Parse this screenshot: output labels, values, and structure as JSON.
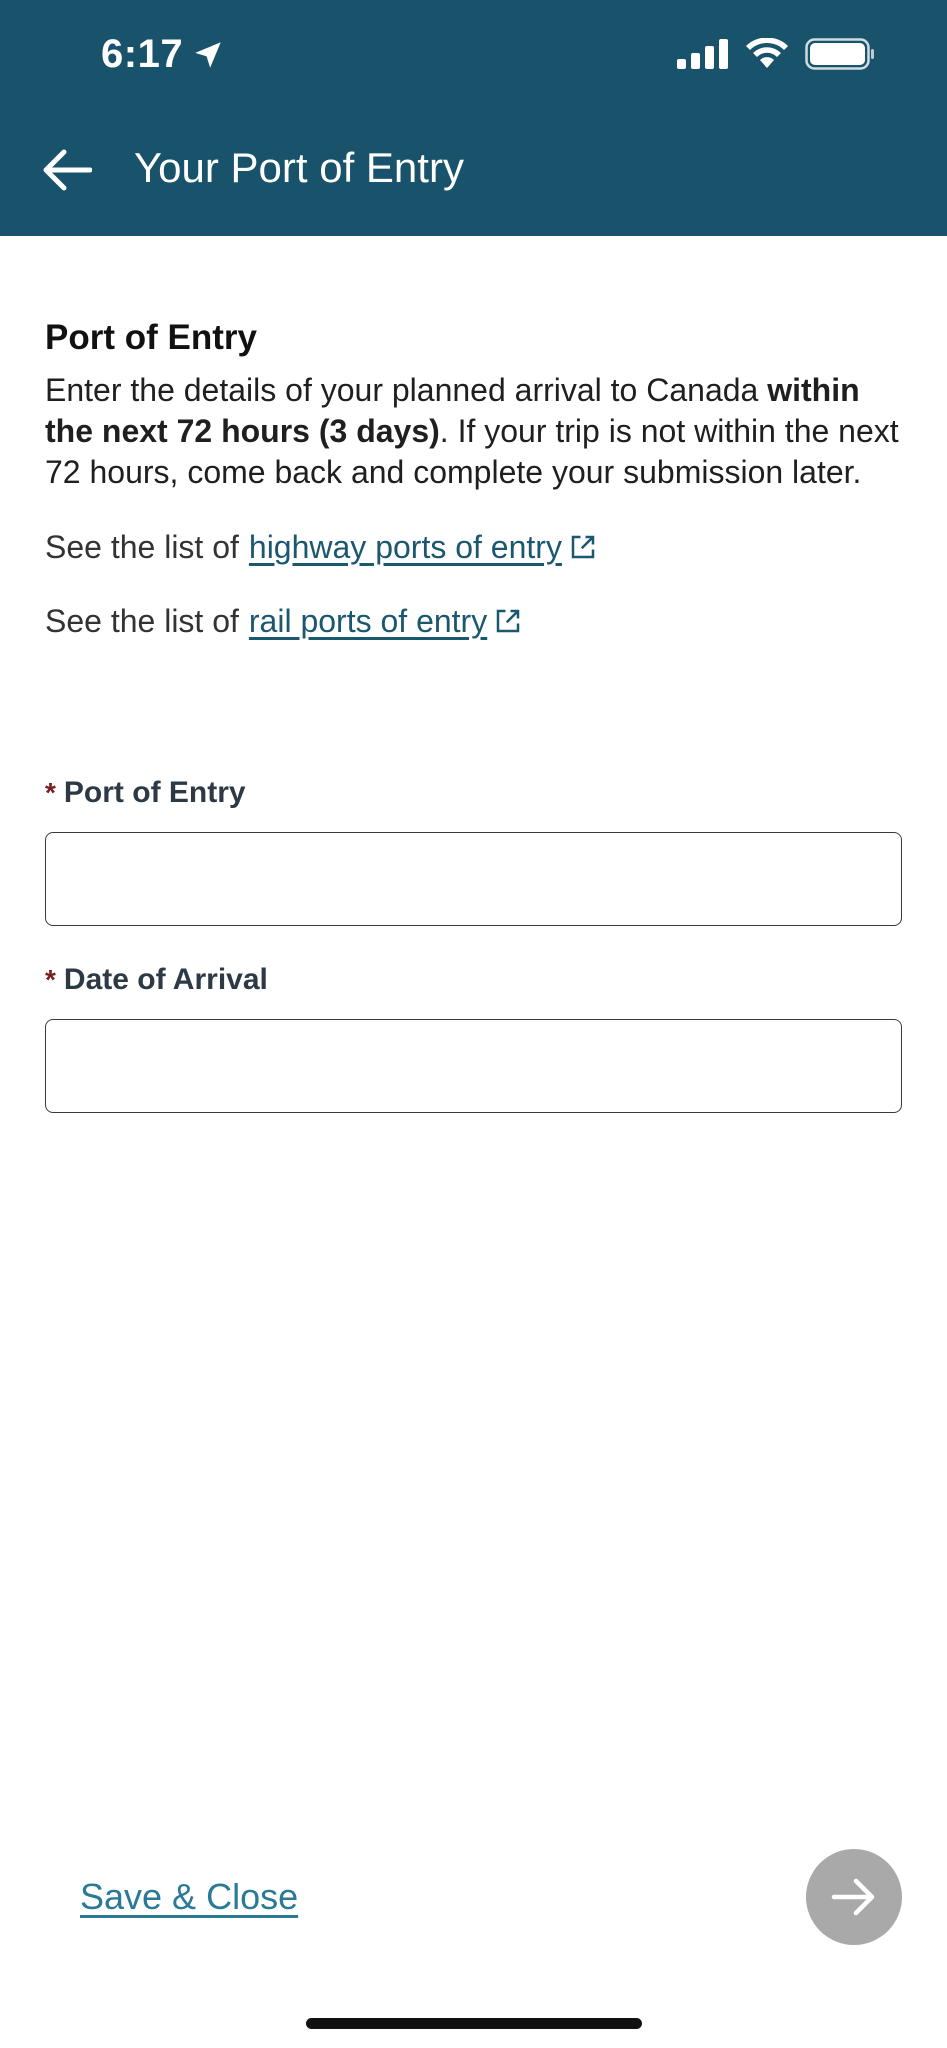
{
  "status_bar": {
    "time": "6:17",
    "location_icon": "location-arrow-icon",
    "signal_icon": "cellular-signal-icon",
    "wifi_icon": "wifi-icon",
    "battery_icon": "battery-icon"
  },
  "header": {
    "back_icon": "arrow-left-icon",
    "title": "Your Port of Entry",
    "background": "#18536b"
  },
  "content": {
    "section_title": "Port of Entry",
    "intro_before": "Enter the details of your planned arrival to Canada ",
    "intro_bold": "within the next 72 hours (3 days)",
    "intro_after": ". If your trip is not within the next 72 hours, come back and complete your submission later.",
    "see_list_prefix": "See the list of",
    "highway_link": "highway ports of entry",
    "rail_link": "rail ports of entry",
    "link_icon": "external-link-icon",
    "link_color": "#1b5870"
  },
  "form": {
    "required_marker": "*",
    "port_label": "Port of Entry",
    "port_value": "",
    "date_label": "Date of Arrival",
    "date_value": ""
  },
  "footer": {
    "save_close": "Save & Close",
    "next_icon": "arrow-right-icon",
    "save_color": "#2a7a96",
    "next_button_color": "#a9a9a9"
  }
}
